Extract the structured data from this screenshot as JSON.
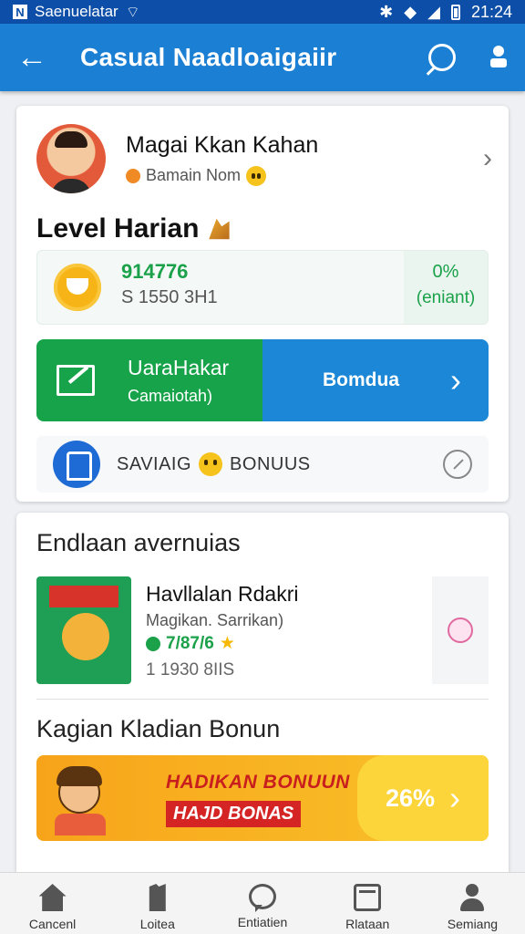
{
  "status_bar": {
    "carrier": "Saenuelatar",
    "time": "21:24"
  },
  "app_bar": {
    "back_glyph": "←",
    "title": "Casual Naadloaigaiir",
    "icons": [
      "search-icon",
      "user-icon"
    ]
  },
  "profile": {
    "name": "Magai Kkan Kahan",
    "subtitle": "Bamain Nom"
  },
  "level": {
    "title": "Level Harian",
    "stat_value": "914776",
    "stat_detail": "S 1550 3H1",
    "side_value": "0%",
    "side_label": "(eniant)"
  },
  "cta": {
    "title": "UaraHakar",
    "subtitle": "Camaiotah)",
    "button_label": "Bomdua",
    "chevron": "›"
  },
  "bonus_row": {
    "label_left": "SAVIAIG",
    "label_right": "BONUUS"
  },
  "section_one": {
    "title": "Endlaan avernuias",
    "item": {
      "title": "Havllalan Rdakri",
      "subtitle": "Magikan. Sarrikan)",
      "rating": "7/87/6",
      "star": "★",
      "meta": "1 1930 8IIS"
    }
  },
  "section_two": {
    "title": "Kagian Kladian Bonun",
    "promo": {
      "title": "HADIKAN BONUUN",
      "subtitle": "HAJD BONAS",
      "percent": "26%",
      "chevron": "›"
    }
  },
  "bottom_nav": {
    "items": [
      {
        "label": "Cancenl",
        "icon": "home-icon"
      },
      {
        "label": "Loitea",
        "icon": "document-icon"
      },
      {
        "label": "Entiatien",
        "icon": "chat-icon"
      },
      {
        "label": "Rlataan",
        "icon": "calendar-icon"
      },
      {
        "label": "Semiang",
        "icon": "profile-icon"
      }
    ]
  },
  "colors": {
    "primary": "#1b7fd4",
    "status_bar": "#0d4fa8",
    "success": "#1aa14a",
    "promo": "#f7a41a"
  }
}
